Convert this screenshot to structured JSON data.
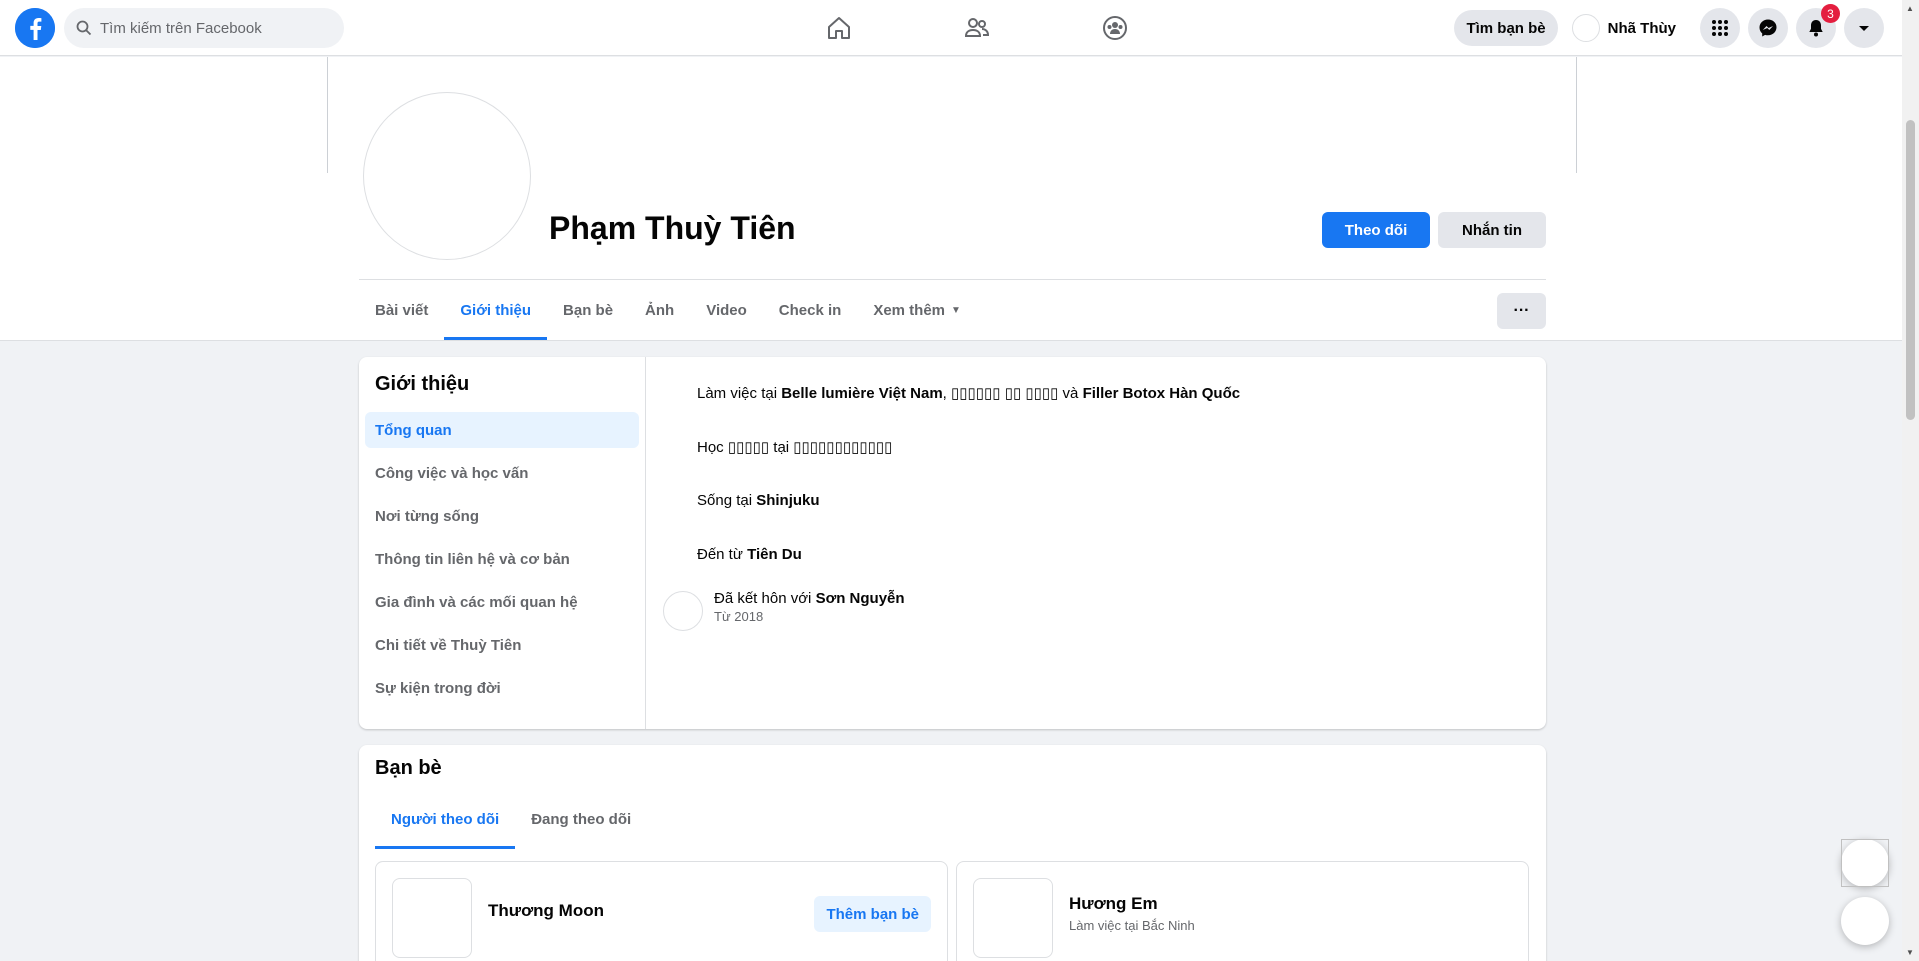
{
  "topbar": {
    "search_placeholder": "Tìm kiếm trên Facebook",
    "find_friends": "Tìm bạn bè",
    "user_name": "Nhã Thùy",
    "notifications_count": "3"
  },
  "profile": {
    "name": "Phạm Thuỳ Tiên",
    "follow_label": "Theo dõi",
    "message_label": "Nhắn tin",
    "more_label": "···",
    "tabs": [
      "Bài viết",
      "Giới thiệu",
      "Bạn bè",
      "Ảnh",
      "Video",
      "Check in",
      "Xem thêm"
    ],
    "active_tab": "Giới thiệu"
  },
  "about": {
    "title": "Giới thiệu",
    "menu": [
      "Tổng quan",
      "Công việc và học vấn",
      "Nơi từng sống",
      "Thông tin liên hệ và cơ bản",
      "Gia đình và các mối quan hệ",
      "Chi tiết về Thuỳ Tiên",
      "Sự kiện trong đời"
    ],
    "work": {
      "prefix": "Làm việc tại ",
      "employer": "Belle lumière Việt Nam",
      "mid": ", ▯▯▯▯▯▯ ▯▯ ▯▯▯▯ và ",
      "employer2": "Filler Botox Hàn Quốc"
    },
    "study": {
      "text": "Học ▯▯▯▯▯ tại ▯▯▯▯▯▯▯▯▯▯▯▯"
    },
    "lives": {
      "prefix": "Sống tại ",
      "place": "Shinjuku"
    },
    "from": {
      "prefix": "Đến từ ",
      "place": "Tiên Du"
    },
    "marriage": {
      "prefix": "Đã kết hôn với ",
      "partner": "Sơn Nguyễn",
      "since": "Từ 2018"
    }
  },
  "friends": {
    "title": "Bạn bè",
    "tabs": [
      "Người theo dõi",
      "Đang theo dõi"
    ],
    "cards": [
      {
        "name": "Thương Moon",
        "subtitle": "",
        "action": "Thêm bạn bè"
      },
      {
        "name": "Hương Em",
        "subtitle": "Làm việc tại Bắc Ninh",
        "action": ""
      }
    ]
  },
  "colors": {
    "accent": "#1877f2",
    "badge": "#e41e3f",
    "background": "#f0f2f5"
  }
}
